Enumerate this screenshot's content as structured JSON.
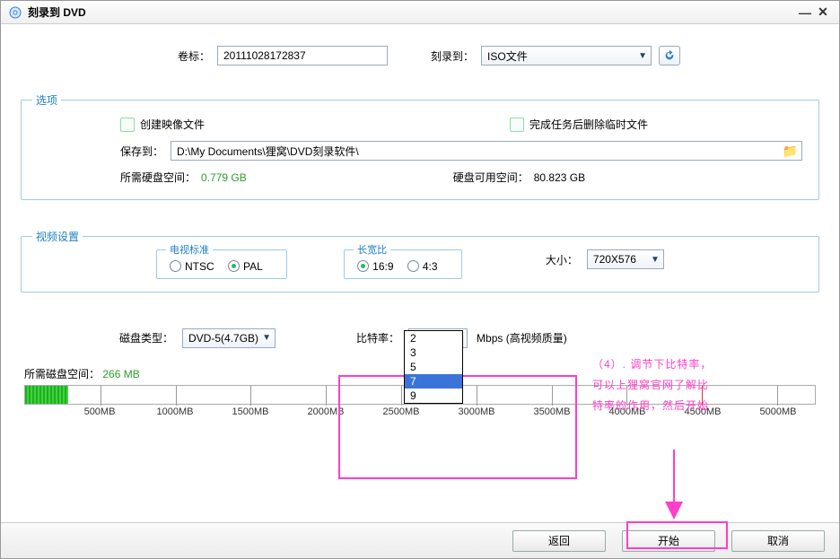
{
  "title": "刻录到 DVD",
  "header": {
    "volume_label_label": "卷标：",
    "volume_label_value": "20111028172837",
    "burn_to_label": "刻录到：",
    "burn_to_value": "ISO文件"
  },
  "options": {
    "legend": "选项",
    "create_image_label": "创建映像文件",
    "delete_temp_label": "完成任务后删除临时文件",
    "save_to_label": "保存到：",
    "save_to_path": "D:\\My Documents\\狸窝\\DVD刻录软件\\",
    "required_space_label": "所需硬盘空间：",
    "required_space_value": "0.779 GB",
    "available_space_label": "硬盘可用空间：",
    "available_space_value": "80.823 GB"
  },
  "video": {
    "legend": "视频设置",
    "tv_standard_legend": "电视标准",
    "ntsc": "NTSC",
    "pal": "PAL",
    "aspect_legend": "长宽比",
    "r169": "16:9",
    "r43": "4:3",
    "size_label": "大小：",
    "size_value": "720X576"
  },
  "lower": {
    "disc_type_label": "磁盘类型：",
    "disc_type_value": "DVD-5(4.7GB)",
    "bitrate_label": "比特率：",
    "bitrate_value": "7",
    "bitrate_unit": "Mbps (高视频质量)",
    "bitrate_options": [
      "2",
      "3",
      "5",
      "7",
      "9"
    ]
  },
  "disk": {
    "required_label": "所需磁盘空间：",
    "required_value": "266 MB",
    "used_percent": 5.5,
    "ticks": [
      "500MB",
      "1000MB",
      "1500MB",
      "2000MB",
      "2500MB",
      "3000MB",
      "3500MB",
      "4000MB",
      "4500MB",
      "5000MB"
    ]
  },
  "buttons": {
    "back": "返回",
    "start": "开始",
    "cancel": "取消"
  },
  "annotation": {
    "line1": "（4）. 调节下比特率，",
    "line2": "可以上狸窝官网了解比",
    "line3": "特率的作用，然后开始"
  }
}
